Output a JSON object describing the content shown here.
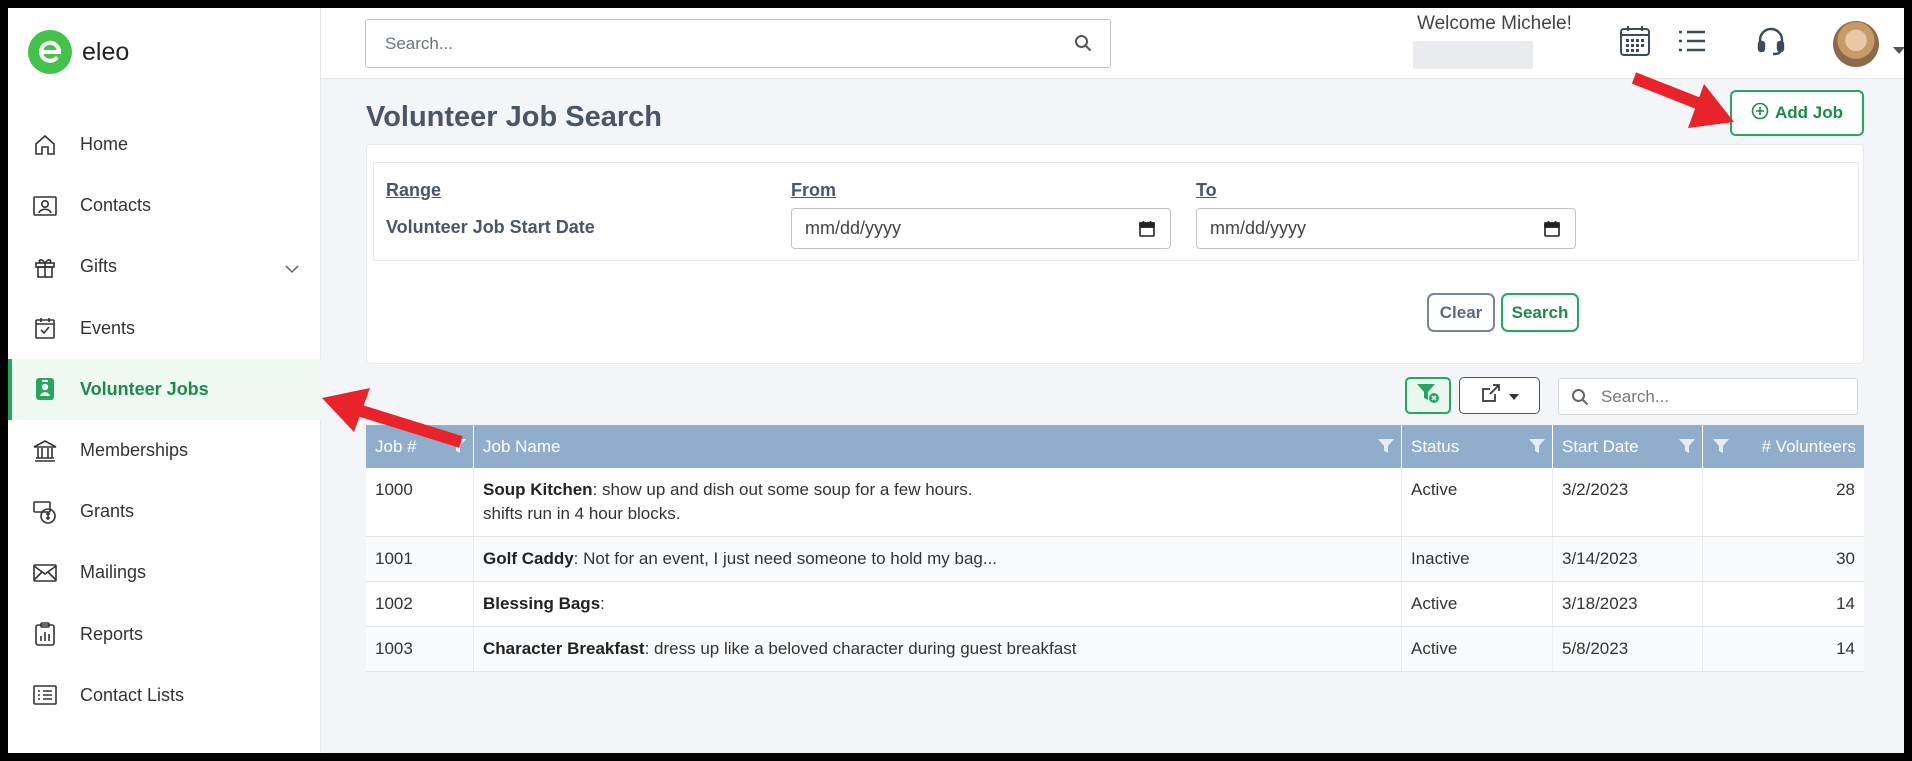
{
  "app": {
    "name": "eleo"
  },
  "sidebar": {
    "items": [
      {
        "label": "Home",
        "icon": "home-icon"
      },
      {
        "label": "Contacts",
        "icon": "contact-card-icon"
      },
      {
        "label": "Gifts",
        "icon": "gift-icon"
      },
      {
        "label": "Events",
        "icon": "calendar-check-icon"
      },
      {
        "label": "Volunteer Jobs",
        "icon": "badge-icon",
        "active": true
      },
      {
        "label": "Memberships",
        "icon": "bank-icon"
      },
      {
        "label": "Grants",
        "icon": "money-icon"
      },
      {
        "label": "Mailings",
        "icon": "envelope-icon"
      },
      {
        "label": "Reports",
        "icon": "clipboard-chart-icon"
      },
      {
        "label": "Contact Lists",
        "icon": "list-icon"
      }
    ]
  },
  "header": {
    "search_placeholder": "Search...",
    "welcome": "Welcome Michele!"
  },
  "page": {
    "title": "Volunteer Job Search",
    "add_job_label": "Add Job"
  },
  "filter": {
    "range_header": "Range",
    "from_header": "From",
    "to_header": "To",
    "range_label": "Volunteer Job Start Date",
    "from_value": "mm/dd/yyyy",
    "to_value": "mm/dd/yyyy",
    "clear_label": "Clear",
    "search_label": "Search"
  },
  "table": {
    "search_placeholder": "Search...",
    "columns": [
      "Job #",
      "Job Name",
      "Status",
      "Start Date",
      "# Volunteers"
    ],
    "rows": [
      {
        "num": "1000",
        "name": "Soup Kitchen",
        "desc": ": show up and dish out some soup for a few hours.",
        "desc2": "shifts run in 4 hour blocks.",
        "status": "Active",
        "start": "3/2/2023",
        "volunteers": "28"
      },
      {
        "num": "1001",
        "name": "Golf Caddy",
        "desc": ": Not for an event, I just need someone to hold my bag...",
        "desc2": "",
        "status": "Inactive",
        "start": "3/14/2023",
        "volunteers": "30"
      },
      {
        "num": "1002",
        "name": "Blessing Bags",
        "desc": ":",
        "desc2": "",
        "status": "Active",
        "start": "3/18/2023",
        "volunteers": "14"
      },
      {
        "num": "1003",
        "name": "Character Breakfast",
        "desc": ": dress up like a beloved character during guest breakfast",
        "desc2": "",
        "status": "Active",
        "start": "5/8/2023",
        "volunteers": "14"
      }
    ]
  },
  "colors": {
    "accent": "#28a55f",
    "header_row": "#90aecb",
    "annotation": "#e8242a"
  }
}
